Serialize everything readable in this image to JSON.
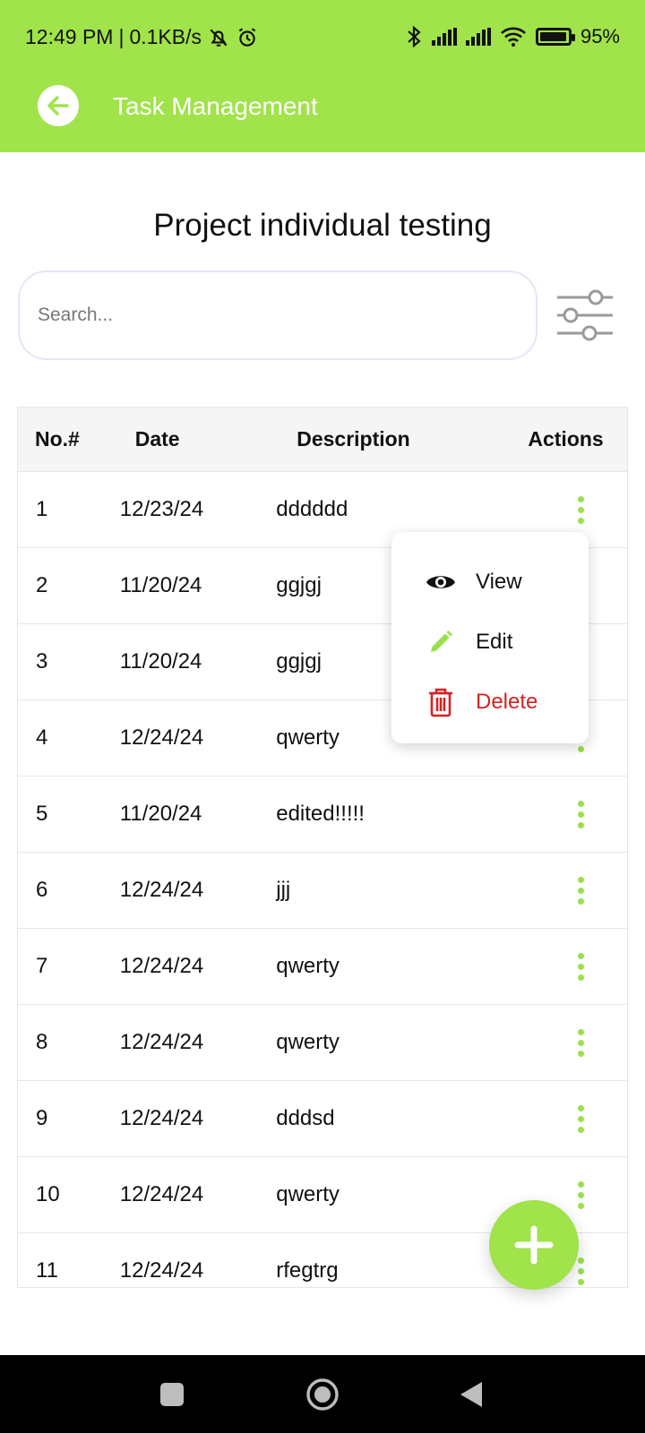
{
  "status_bar": {
    "time": "12:49 PM",
    "separator": "|",
    "speed": "0.1KB/s",
    "battery": "95%",
    "battery_level": 0.95,
    "icons": [
      "mute-bell-icon",
      "alarm-icon",
      "bluetooth-icon",
      "signal-icon",
      "signal-icon",
      "wifi-icon",
      "battery-icon"
    ]
  },
  "appbar": {
    "title": "Task Management",
    "back_icon": "back-arrow-icon"
  },
  "page": {
    "title": "Project individual testing"
  },
  "search": {
    "placeholder": "Search...",
    "value": ""
  },
  "filter": {
    "icon": "sliders-icon"
  },
  "table": {
    "headers": {
      "no": "No.#",
      "date": "Date",
      "description": "Description",
      "actions": "Actions"
    },
    "rows": [
      {
        "no": "1",
        "date": "12/23/24",
        "description": "dddddd"
      },
      {
        "no": "2",
        "date": "11/20/24",
        "description": "ggjgj"
      },
      {
        "no": "3",
        "date": "11/20/24",
        "description": "ggjgj"
      },
      {
        "no": "4",
        "date": "12/24/24",
        "description": "qwerty"
      },
      {
        "no": "5",
        "date": "11/20/24",
        "description": "edited!!!!!"
      },
      {
        "no": "6",
        "date": "12/24/24",
        "description": "jjj"
      },
      {
        "no": "7",
        "date": "12/24/24",
        "description": "qwerty"
      },
      {
        "no": "8",
        "date": "12/24/24",
        "description": "qwerty"
      },
      {
        "no": "9",
        "date": "12/24/24",
        "description": "dddsd"
      },
      {
        "no": "10",
        "date": "12/24/24",
        "description": "qwerty"
      },
      {
        "no": "11",
        "date": "12/24/24",
        "description": "rfegtrg"
      }
    ]
  },
  "actions_menu": {
    "items": [
      {
        "label": "View",
        "icon": "eye-icon"
      },
      {
        "label": "Edit",
        "icon": "pencil-icon"
      },
      {
        "label": "Delete",
        "icon": "trash-icon"
      }
    ]
  },
  "fab": {
    "icon": "plus-icon"
  },
  "colors": {
    "accent": "#a0e34a",
    "danger": "#d32222",
    "header_bg": "#f5f5f6"
  }
}
